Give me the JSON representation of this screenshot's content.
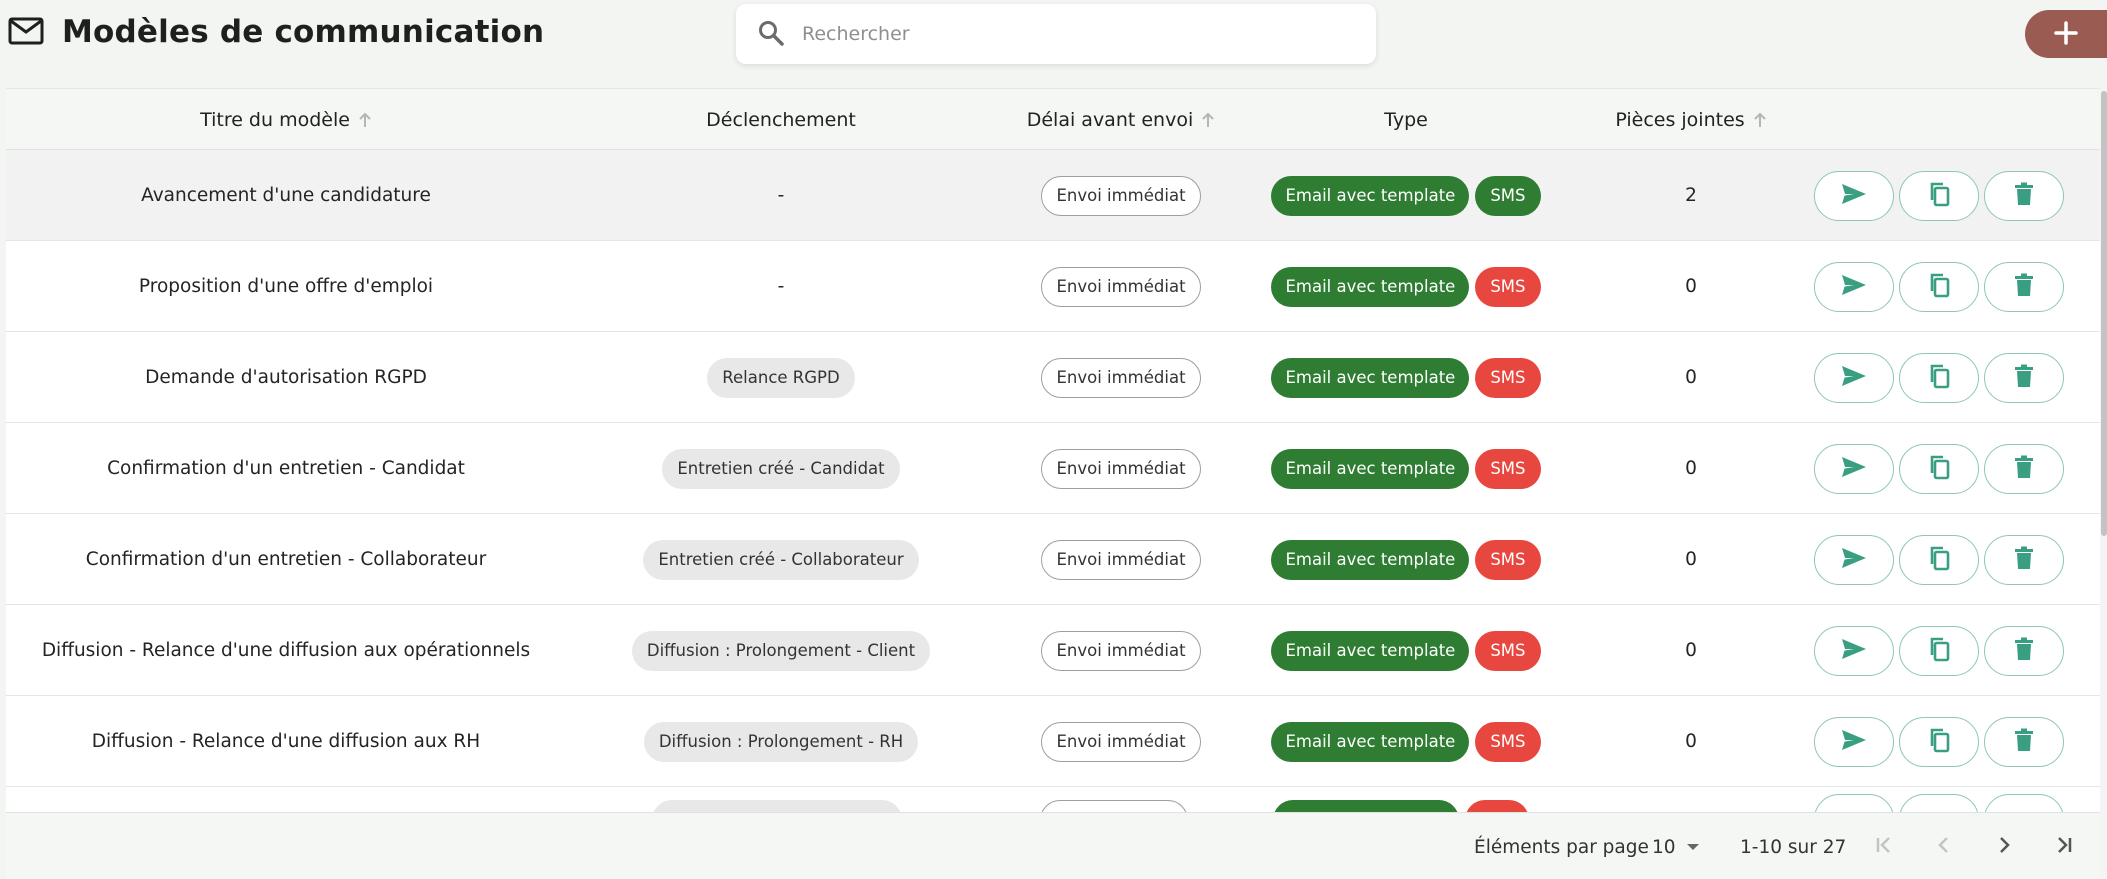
{
  "header": {
    "title": "Modèles de communication",
    "search_placeholder": "Rechercher"
  },
  "columns": {
    "title": "Titre du modèle",
    "trigger": "Déclenchement",
    "delay": "Délai avant envoi",
    "type": "Type",
    "attachments": "Pièces jointes"
  },
  "rows": [
    {
      "title": "Avancement d'une candidature",
      "trigger": "-",
      "delay": "Envoi immédiat",
      "email": "Email avec template",
      "sms": "SMS",
      "sms_color": "#2e7d32",
      "attachments": "2"
    },
    {
      "title": "Proposition d'une offre d'emploi",
      "trigger": "-",
      "delay": "Envoi immédiat",
      "email": "Email avec template",
      "sms": "SMS",
      "sms_color": "#e8473f",
      "attachments": "0"
    },
    {
      "title": "Demande d'autorisation RGPD",
      "trigger": "Relance RGPD",
      "delay": "Envoi immédiat",
      "email": "Email avec template",
      "sms": "SMS",
      "sms_color": "#e8473f",
      "attachments": "0"
    },
    {
      "title": "Confirmation d'un entretien - Candidat",
      "trigger": "Entretien créé - Candidat",
      "delay": "Envoi immédiat",
      "email": "Email avec template",
      "sms": "SMS",
      "sms_color": "#e8473f",
      "attachments": "0"
    },
    {
      "title": "Confirmation d'un entretien - Collaborateur",
      "trigger": "Entretien créé - Collaborateur",
      "delay": "Envoi immédiat",
      "email": "Email avec template",
      "sms": "SMS",
      "sms_color": "#e8473f",
      "attachments": "0"
    },
    {
      "title": "Diffusion - Relance d'une diffusion aux opérationnels",
      "trigger": "Diffusion : Prolongement - Client",
      "delay": "Envoi immédiat",
      "email": "Email avec template",
      "sms": "SMS",
      "sms_color": "#e8473f",
      "attachments": "0"
    },
    {
      "title": "Diffusion - Relance d'une diffusion aux RH",
      "trigger": "Diffusion : Prolongement - RH",
      "delay": "Envoi immédiat",
      "email": "Email avec template",
      "sms": "SMS",
      "sms_color": "#e8473f",
      "attachments": "0"
    }
  ],
  "footer": {
    "per_page_label": "Éléments par page",
    "per_page_value": "10",
    "range": "1-10 sur 27"
  },
  "colors": {
    "accent_green": "#2e7d32",
    "sms_red": "#e8473f",
    "add_button": "#9a5b52",
    "action_icon": "#3a9f82"
  },
  "icons": {
    "header": "mail-icon",
    "search": "search-icon",
    "add": "plus-icon",
    "row_actions": [
      "send-icon",
      "copy-icon",
      "trash-icon"
    ],
    "pager": [
      "first-page-icon",
      "prev-page-icon",
      "next-page-icon",
      "last-page-icon"
    ]
  }
}
